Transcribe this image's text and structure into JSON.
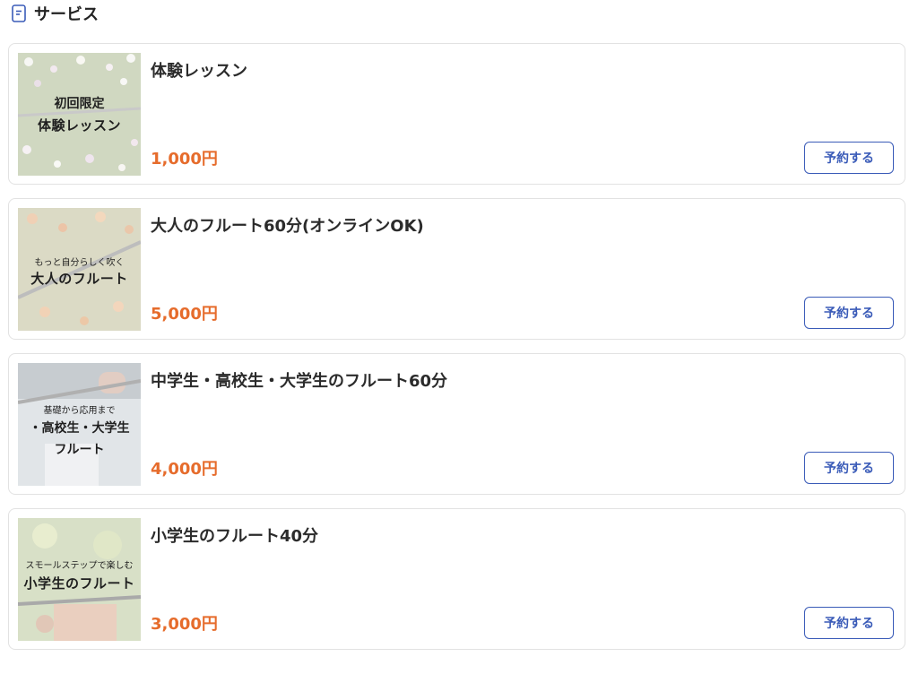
{
  "section": {
    "title": "サービス",
    "icon": "document-icon"
  },
  "colors": {
    "price": "#e66c2c",
    "button": "#3a5bb8"
  },
  "services": [
    {
      "title": "体験レッスン",
      "price": "1,000円",
      "button_label": "予約する",
      "thumb": {
        "line1": "初回限定",
        "line2": "体験レッスン"
      }
    },
    {
      "title": "大人のフルート60分(オンラインOK)",
      "price": "5,000円",
      "button_label": "予約する",
      "thumb": {
        "line1": "もっと自分らしく吹く",
        "line2": "大人のフルート"
      }
    },
    {
      "title": "中学生・高校生・大学生のフルート60分",
      "price": "4,000円",
      "button_label": "予約する",
      "thumb": {
        "line1": "基礎から応用まで",
        "line2": "・高校生・大学生",
        "line3": "フルート"
      }
    },
    {
      "title": "小学生のフルート40分",
      "price": "3,000円",
      "button_label": "予約する",
      "thumb": {
        "line1": "スモールステップで楽しむ",
        "line2": "小学生のフルート"
      }
    }
  ]
}
